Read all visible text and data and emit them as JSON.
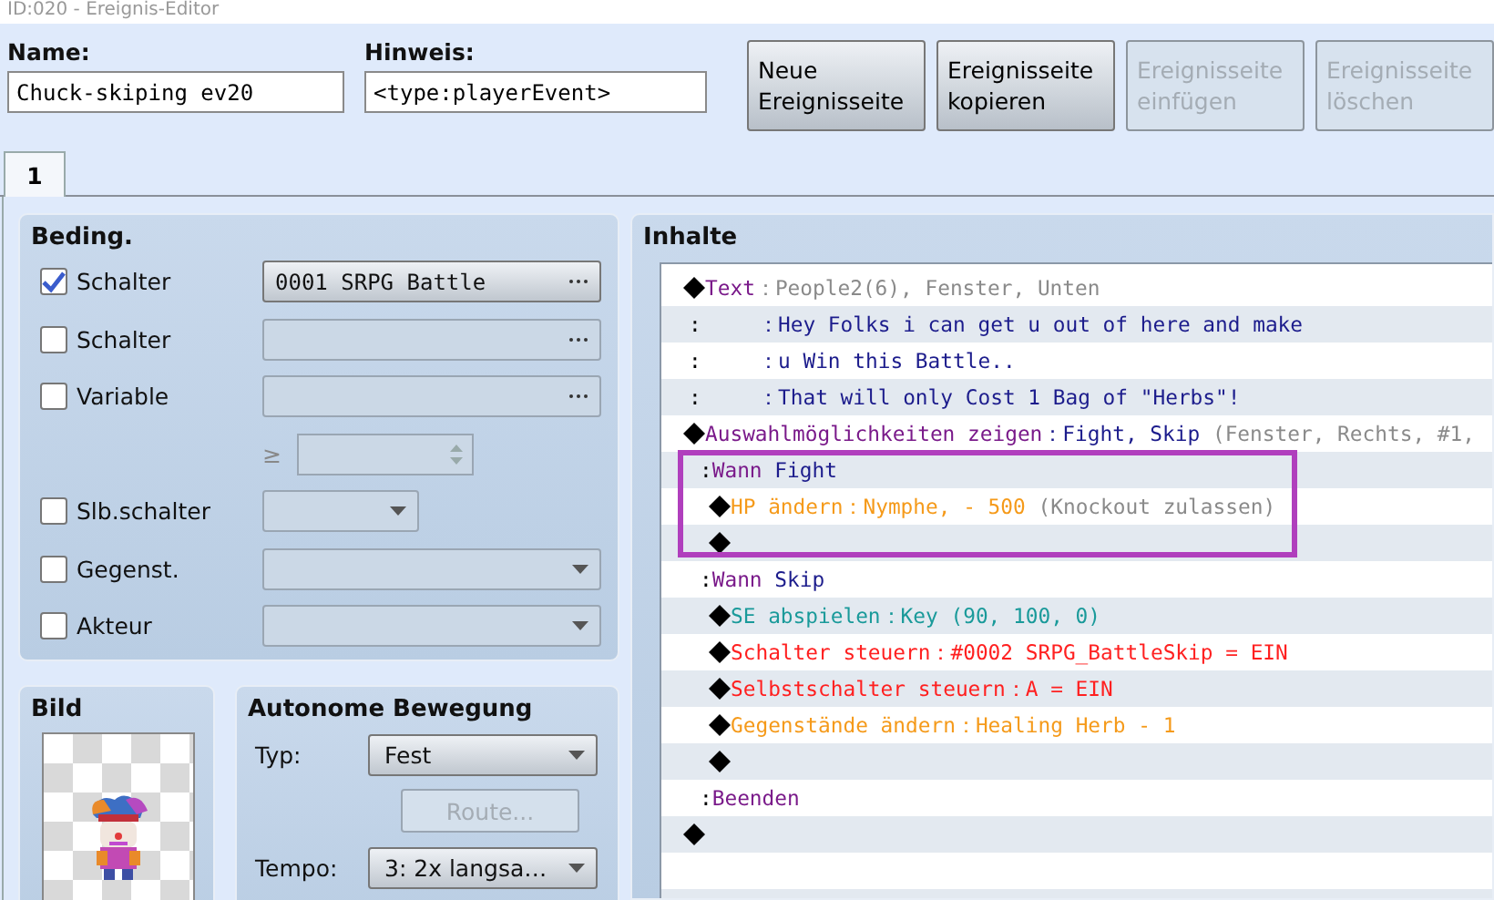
{
  "window": {
    "title": "ID:020 - Ereignis-Editor"
  },
  "name_field": {
    "label": "Name:",
    "value": "Chuck-skiping ev20"
  },
  "note_field": {
    "label": "Hinweis:",
    "value": "<type:playerEvent>"
  },
  "page_buttons": [
    {
      "label": "Neue\nEreignisseite",
      "disabled": false
    },
    {
      "label": "Ereignisseite\nkopieren",
      "disabled": false
    },
    {
      "label": "Ereignisseite\neinfügen",
      "disabled": true
    },
    {
      "label": "Ereignisseite\nlöschen",
      "disabled": true
    }
  ],
  "tabs": [
    {
      "label": "1",
      "selected": true
    }
  ],
  "conditions": {
    "title": "Beding.",
    "rows": [
      {
        "kind": "picker",
        "label": "Schalter",
        "checked": true,
        "value": "0001 SRPG Battle"
      },
      {
        "kind": "picker",
        "label": "Schalter",
        "checked": false
      },
      {
        "kind": "picker",
        "label": "Variable",
        "checked": false
      },
      {
        "kind": "comparison",
        "operator": "≥"
      },
      {
        "kind": "short-dropdown",
        "label": "Slb.schalter",
        "checked": false
      },
      {
        "kind": "dropdown",
        "label": "Gegenst.",
        "checked": false
      },
      {
        "kind": "dropdown",
        "label": "Akteur",
        "checked": false
      }
    ]
  },
  "image": {
    "title": "Bild"
  },
  "movement": {
    "title": "Autonome Bewegung",
    "type_label": "Typ:",
    "type_value": "Fest",
    "route_button": {
      "label": "Route...",
      "disabled": true
    },
    "speed_label": "Tempo:",
    "speed_value": "3: 2x langsa…"
  },
  "contents": {
    "title": "Inhalte",
    "commands": [
      {
        "kind": "command",
        "parts": [
          {
            "text": "Text",
            "color": "#7a1a8a"
          },
          {
            "text": "：People2(6), Fenster, Unten",
            "color": "#8a8a8a"
          }
        ]
      },
      {
        "kind": "continuation",
        "parts": [
          {
            "text": ":",
            "color": "#000000"
          },
          {
            "text": "：Hey Folks i can get u out of here and make",
            "color": "#1c1c8c"
          }
        ]
      },
      {
        "kind": "continuation",
        "parts": [
          {
            "text": ":",
            "color": "#000000"
          },
          {
            "text": "：u Win this Battle..",
            "color": "#1c1c8c"
          }
        ]
      },
      {
        "kind": "continuation",
        "parts": [
          {
            "text": ":",
            "color": "#000000"
          },
          {
            "text": "：That will only Cost 1 Bag of \"Herbs\"!",
            "color": "#1c1c8c"
          }
        ]
      },
      {
        "kind": "command",
        "parts": [
          {
            "text": "Auswahlmöglichkeiten zeigen",
            "color": "#7a1a8a"
          },
          {
            "text": "：Fight, Skip",
            "color": "#1c1c8c"
          },
          {
            "text": " (Fenster, Rechts, #1,",
            "color": "#8a8a8a"
          }
        ],
        "children": [
          {
            "kind": "branch",
            "highlighted": true,
            "parts": [
              {
                "text": ":",
                "color": "#000000"
              },
              {
                "text": "Wann",
                "color": "#7a1a8a"
              },
              {
                "text": " Fight",
                "color": "#1c1c8c"
              }
            ],
            "children": [
              {
                "kind": "command",
                "parts": [
                  {
                    "text": "HP ändern",
                    "color": "#f59a1a"
                  },
                  {
                    "text": "：Nymphe, - 500",
                    "color": "#f59a1a"
                  },
                  {
                    "text": " (Knockout zulassen)",
                    "color": "#8a8a8a"
                  }
                ]
              },
              {
                "kind": "empty"
              }
            ]
          },
          {
            "kind": "branch",
            "highlighted": false,
            "parts": [
              {
                "text": ":",
                "color": "#000000"
              },
              {
                "text": "Wann",
                "color": "#7a1a8a"
              },
              {
                "text": " Skip",
                "color": "#1c1c8c"
              }
            ],
            "children": [
              {
                "kind": "command",
                "parts": [
                  {
                    "text": "SE abspielen",
                    "color": "#1a9a9a"
                  },
                  {
                    "text": "：Key (90, 100, 0)",
                    "color": "#1a9a9a"
                  }
                ]
              },
              {
                "kind": "command",
                "parts": [
                  {
                    "text": "Schalter steuern",
                    "color": "#ff2020"
                  },
                  {
                    "text": "：#0002 SRPG_BattleSkip = EIN",
                    "color": "#ff2020"
                  }
                ]
              },
              {
                "kind": "command",
                "parts": [
                  {
                    "text": "Selbstschalter steuern",
                    "color": "#ff2020"
                  },
                  {
                    "text": "：A = EIN",
                    "color": "#ff2020"
                  }
                ]
              },
              {
                "kind": "command",
                "parts": [
                  {
                    "text": "Gegenstände ändern",
                    "color": "#f59a1a"
                  },
                  {
                    "text": "：Healing Herb - 1",
                    "color": "#f59a1a"
                  }
                ]
              },
              {
                "kind": "empty"
              }
            ]
          },
          {
            "kind": "branch",
            "highlighted": false,
            "parts": [
              {
                "text": ":",
                "color": "#000000"
              },
              {
                "text": "Beenden",
                "color": "#7a1a8a"
              }
            ]
          }
        ]
      },
      {
        "kind": "empty"
      }
    ]
  }
}
